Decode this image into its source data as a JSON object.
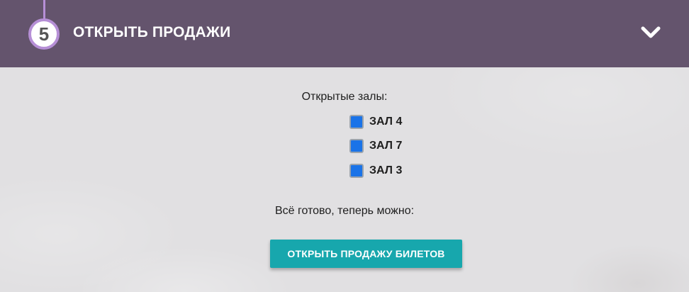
{
  "step": {
    "number": "5",
    "title": "ОТКРЫТЬ ПРОДАЖИ",
    "toggle_icon": "chevron-down-icon"
  },
  "halls": {
    "label": "Открытые залы:",
    "items": [
      {
        "label": "ЗАЛ 4",
        "checked": true
      },
      {
        "label": "ЗАЛ 7",
        "checked": true
      },
      {
        "label": "ЗАЛ 3",
        "checked": true
      }
    ]
  },
  "ready_text": "Всё готово, теперь можно:",
  "open_sales_button": "ОТКРЫТЬ ПРОДАЖУ БИЛЕТОВ",
  "colors": {
    "header_bg": "#64546d",
    "accent_purple": "#b68fd6",
    "checkbox_blue": "#1a73e8",
    "button_teal": "#17a7ad"
  }
}
